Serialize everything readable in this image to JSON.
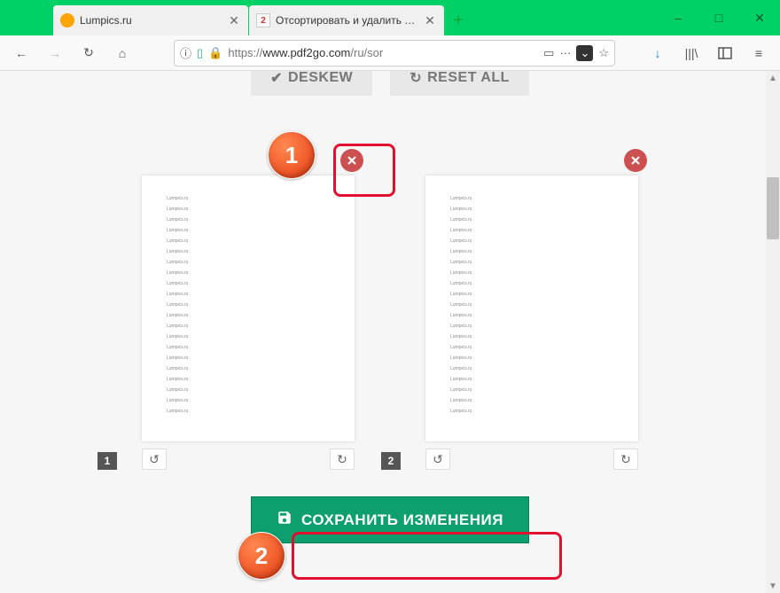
{
  "window": {
    "minimize": "–",
    "maximize": "□",
    "close": "✕"
  },
  "tabs": [
    {
      "label": "Lumpics.ru",
      "favicon": "orange"
    },
    {
      "label": "Отсортировать и удалить — О...",
      "favicon": "pdf2go"
    }
  ],
  "newtab": "+",
  "toolbar": {
    "back": "←",
    "forward": "→",
    "reload": "↻",
    "home": "⌂",
    "info": "ⓘ",
    "shield": "🛡",
    "lock": "🔒",
    "url_prefix": "https://",
    "url_domain": "www.pdf2go.com",
    "url_path": "/ru/sor",
    "dots": "···",
    "reader": "▭",
    "pocket": "▾",
    "star": "☆",
    "download": "↓",
    "library": "|||\\",
    "sidebar": "▫",
    "menu": "≡"
  },
  "buttons": {
    "deskew": "DESKEW",
    "reset": "RESET ALL",
    "save": "СОХРАНИТЬ ИЗМЕНЕНИЯ"
  },
  "pages": [
    {
      "num": "1",
      "text": "Lumpics.ru"
    },
    {
      "num": "2",
      "text": "Lumpics.ru"
    }
  ],
  "callouts": {
    "one": "1",
    "two": "2"
  },
  "icons": {
    "check": "✔",
    "refresh": "↻",
    "rotate_ccw": "↺",
    "rotate_cw": "↻",
    "save_disk": "💾",
    "delete_x": "✖"
  }
}
